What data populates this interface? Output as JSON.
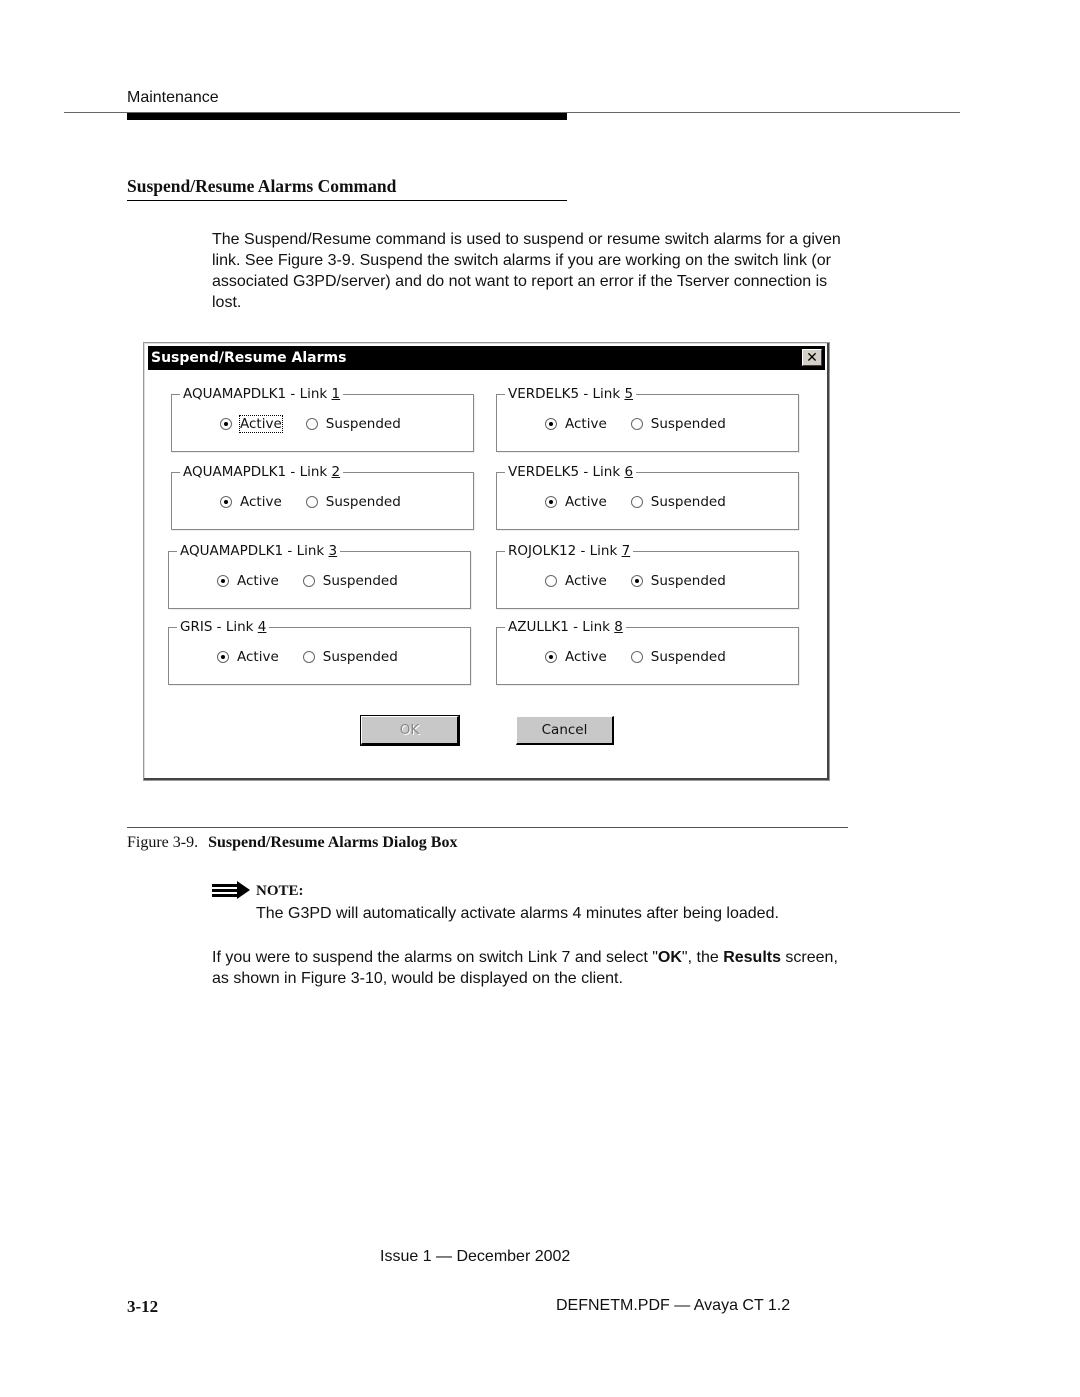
{
  "header": {
    "running_head": "Maintenance"
  },
  "section": {
    "title": "Suspend/Resume Alarms Command",
    "intro": "The Suspend/Resume command is used to suspend or resume switch alarms for a given link. See Figure 3-9. Suspend the switch alarms if you are working on the switch link (or associated G3PD/server) and do not want to report an error if the Tserver connection is lost."
  },
  "dialog": {
    "title": "Suspend/Resume Alarms",
    "close_icon": "close-icon",
    "option_active": "Active",
    "option_suspended": "Suspended",
    "groups": [
      {
        "name": "AQUAMAPDLK1 - Link ",
        "link": "1",
        "state": "Active",
        "focused": true
      },
      {
        "name": "AQUAMAPDLK1 - Link ",
        "link": "2",
        "state": "Active"
      },
      {
        "name": "AQUAMAPDLK1 - Link ",
        "link": "3",
        "state": "Active"
      },
      {
        "name": "GRIS - Link ",
        "link": "4",
        "state": "Active"
      },
      {
        "name": "VERDELK5 - Link ",
        "link": "5",
        "state": "Active"
      },
      {
        "name": "VERDELK5 - Link ",
        "link": "6",
        "state": "Active"
      },
      {
        "name": "ROJOLK12 - Link ",
        "link": "7",
        "state": "Suspended"
      },
      {
        "name": "AZULLK1 - Link ",
        "link": "8",
        "state": "Active"
      }
    ],
    "ok_label": "OK",
    "cancel_label": "Cancel"
  },
  "figure": {
    "label": "Figure 3-9.",
    "title": "Suspend/Resume Alarms Dialog Box"
  },
  "note": {
    "icon": "note-arrow-icon",
    "label": "NOTE:",
    "text": "The G3PD will automatically activate alarms 4 minutes after being loaded."
  },
  "followup": {
    "part1": "If you were to suspend the alarms on switch Link 7 and select \"",
    "ok_bold": "OK",
    "part2": "\", the ",
    "results_bold": "Results",
    "part3": " screen, as shown in Figure 3-10, would be displayed on the client."
  },
  "footer": {
    "issue": "Issue 1 — December 2002",
    "page_number": "3-12",
    "doc_id": "DEFNETM.PDF — Avaya CT 1.2"
  }
}
